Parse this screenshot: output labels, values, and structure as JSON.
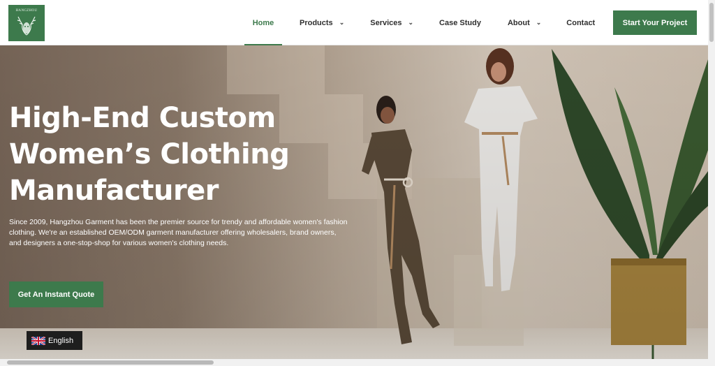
{
  "header": {
    "logo_text": "HANGZHOU",
    "nav": [
      {
        "label": "Home",
        "active": true,
        "dropdown": false
      },
      {
        "label": "Products",
        "active": false,
        "dropdown": true
      },
      {
        "label": "Services",
        "active": false,
        "dropdown": true
      },
      {
        "label": "Case Study",
        "active": false,
        "dropdown": false
      },
      {
        "label": "About",
        "active": false,
        "dropdown": true
      },
      {
        "label": "Contact",
        "active": false,
        "dropdown": false
      }
    ],
    "cta_label": "Start Your Project"
  },
  "hero": {
    "title_line1": "High-End Custom",
    "title_line2": "Women’s Clothing",
    "title_line3": "Manufacturer",
    "description": "Since 2009, Hangzhou Garment has been the premier source for trendy and affordable women's fashion clothing. We're an established OEM/ODM garment manufacturer offering wholesalers, brand owners, and designers a one-stop-shop for various women's clothing needs.",
    "button_label": "Get An Instant Quote"
  },
  "language": {
    "label": "English",
    "flag_icon": "uk-flag-icon"
  },
  "colors": {
    "accent": "#3d7a4c"
  }
}
